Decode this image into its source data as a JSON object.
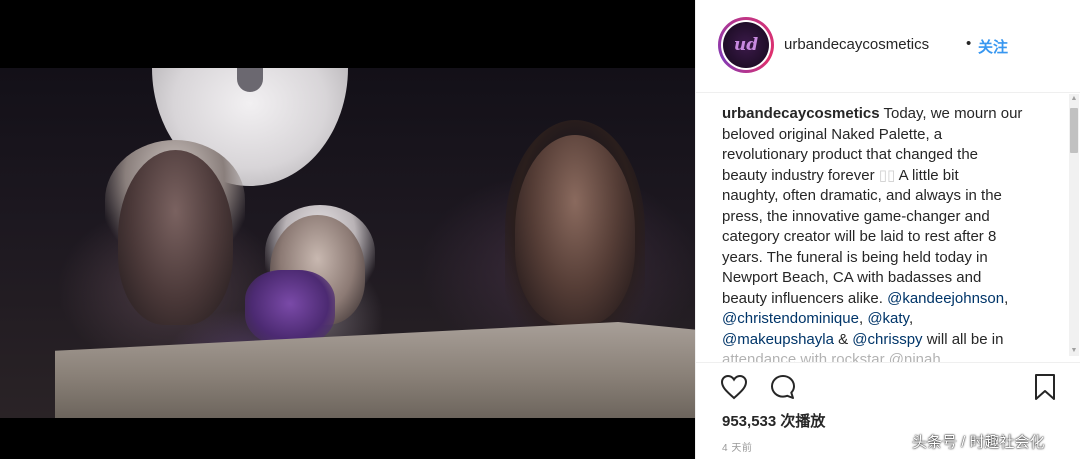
{
  "post": {
    "username": "urbandecaycosmetics",
    "avatar_text": "ud",
    "dot": "•",
    "follow_label": "关注",
    "caption": {
      "user": "urbandecaycosmetics",
      "lines": [
        " Today, we mourn our",
        "beloved original Naked Palette, a",
        "revolutionary product that changed the",
        "beauty industry forever",
        "A little bit",
        "naughty, often dramatic, and always in the",
        "press, the innovative game-changer and",
        "category creator will be laid to rest after 8",
        "years. The funeral is being held today in",
        "Newport Beach, CA with badasses and",
        "beauty influencers alike. "
      ],
      "emoji": "▯▯",
      "mentions": [
        "@kandeejohnson",
        "@christendominique",
        "@katy",
        "@makeupshayla",
        "@chrisspy"
      ],
      "separator_comma": ",",
      "separator_and": " & ",
      "tail": " will all be in",
      "cutoff_line": "attendance with rockstar @ninah..."
    },
    "views": "953,533 次播放",
    "time_ago": "4 天前"
  },
  "icons": {
    "like": "heart-icon",
    "comment": "comment-icon",
    "save": "bookmark-icon"
  },
  "scrollbar": {
    "up": "▲",
    "down": "▼"
  },
  "watermark": "头条号 / 时趣社会化",
  "colors": {
    "follow": "#3897f0",
    "mention": "#003569",
    "text": "#262626",
    "muted": "#999999"
  }
}
